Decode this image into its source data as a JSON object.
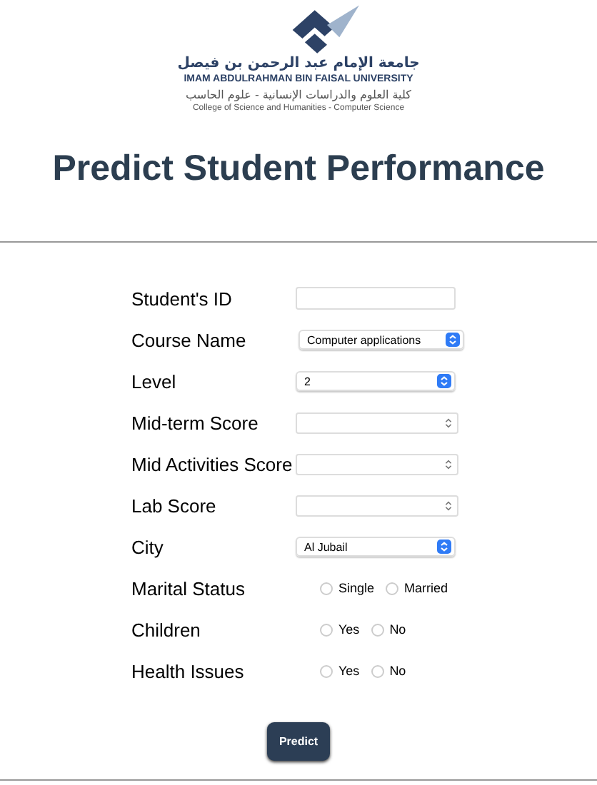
{
  "logo": {
    "arabic_name": "جامعة الإمام عبد الرحمن بن فيصل",
    "english_name": "IMAM ABDULRAHMAN BIN FAISAL UNIVERSITY",
    "arabic_college": "كلية العلوم والدراسات الإنسانية - علوم الحاسب",
    "english_college": "College of Science and Humanities - Computer Science"
  },
  "title": "Predict Student Performance",
  "fields": [
    {
      "label": "Student's ID",
      "kind": "text"
    },
    {
      "label": "Course Name",
      "kind": "select",
      "value": "Computer applications"
    },
    {
      "label": "Level",
      "kind": "select",
      "value": "2"
    },
    {
      "label": "Mid-term Score",
      "kind": "number"
    },
    {
      "label": "Mid Activities Score",
      "kind": "number"
    },
    {
      "label": "Lab Score",
      "kind": "number"
    },
    {
      "label": "City",
      "kind": "select",
      "value": "Al Jubail"
    },
    {
      "label": "Marital Status",
      "kind": "radio",
      "options": [
        {
          "label": "Single",
          "selected": false
        },
        {
          "label": "Married",
          "selected": false
        }
      ]
    },
    {
      "label": "Children",
      "kind": "radio",
      "options": [
        {
          "label": "Yes",
          "selected": false
        },
        {
          "label": "No",
          "selected": false
        }
      ]
    },
    {
      "label": "Health Issues",
      "kind": "radio",
      "options": [
        {
          "label": "Yes",
          "selected": false
        },
        {
          "label": "No",
          "selected": false
        }
      ]
    }
  ],
  "button": "Predict"
}
